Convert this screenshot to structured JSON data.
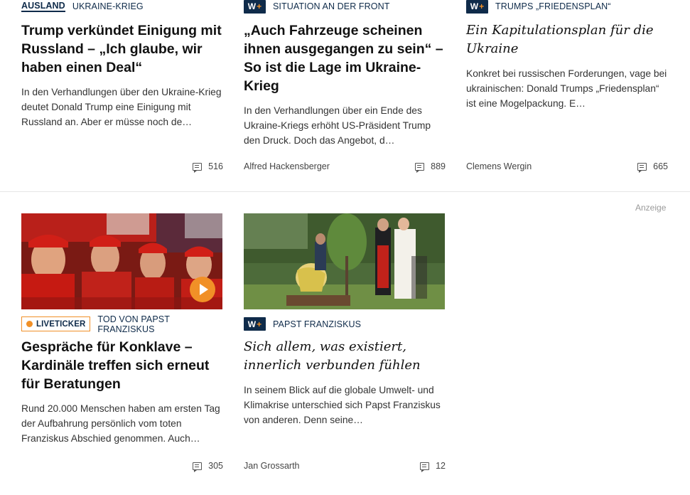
{
  "cards_top": [
    {
      "section": "AUSLAND",
      "topic": "UKRAINE-KRIEG",
      "headline": "Trump verkündet Einigung mit Russland – „Ich glaube, wir haben einen Deal“",
      "teaser": "In den Verhandlungen über den Ukraine-Krieg deutet Donald Trump eine Einigung mit Russland an. Aber er müsse noch de…",
      "author": "",
      "comments": "516"
    },
    {
      "badge": "W+",
      "topic": "SITUATION AN DER FRONT",
      "headline": "„Auch Fahrzeuge scheinen ihnen ausgegangen zu sein“ – So ist die Lage im Ukraine-Krieg",
      "teaser": "In den Verhandlungen über ein Ende des Ukraine-Kriegs erhöht US-Präsident Trump den Druck. Doch das Angebot, d…",
      "author": "Alfred Hackensberger",
      "comments": "889"
    },
    {
      "badge": "W+",
      "topic": "TRUMPS „FRIEDENSPLAN“",
      "headline": "Ein Kapitulationsplan für die Ukraine",
      "teaser": "Konkret bei russischen Forderungen, vage bei ukrainischen: Donald Trumps „Friedensplan“ ist eine Mogelpackung. E…",
      "author": "Clemens Wergin",
      "comments": "665"
    }
  ],
  "cards_bottom": [
    {
      "live_label": "LIVETICKER",
      "topic": "TOD VON PAPST FRANZISKUS",
      "headline": "Gespräche für Konklave – Kardinäle treffen sich erneut für Beratungen",
      "teaser": "Rund 20.000 Menschen haben am ersten Tag der Aufbahrung persönlich vom toten Franziskus Abschied genommen. Auch…",
      "author": "",
      "comments": "305"
    },
    {
      "badge": "W+",
      "topic": "PAPST FRANZISKUS",
      "headline": "Sich allem, was existiert, innerlich verbunden fühlen",
      "teaser": "In seinem Blick auf die globale Umwelt- und Klimakrise unterschied sich Papst Franziskus von anderen. Denn seine…",
      "author": "Jan Grossarth",
      "comments": "12"
    }
  ],
  "ad_label": "Anzeige",
  "icons": {
    "comment": "comment-icon",
    "play": "play-icon",
    "live": "live-dot-icon"
  },
  "colors": {
    "navy": "#0f2b4a",
    "orange": "#f19027"
  }
}
